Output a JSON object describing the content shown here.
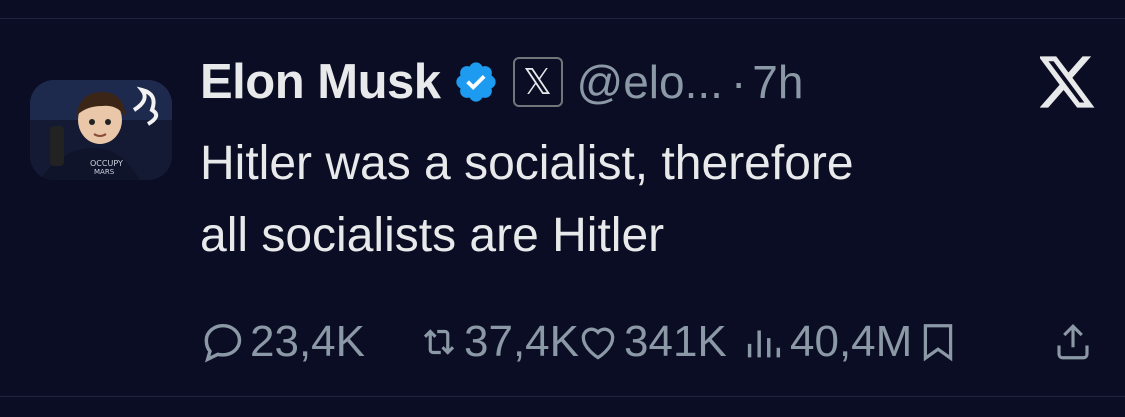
{
  "tweet": {
    "author_name": "Elon Musk",
    "verified_icon": "verified-badge-icon",
    "affiliate_badge_icon": "x-affiliate-icon",
    "affiliate_badge_text": "𝕏",
    "handle": "@elo...",
    "separator": "·",
    "time": "7h",
    "text_lines": [
      "Hitler was a socialist, therefore",
      "all socialists are Hitler"
    ]
  },
  "actions": {
    "reply": {
      "icon": "reply-icon",
      "count": "23,4K"
    },
    "repost": {
      "icon": "repost-icon",
      "count": "37,4K"
    },
    "like": {
      "icon": "heart-icon",
      "count": "341K"
    },
    "views": {
      "icon": "views-icon",
      "count": "40,4M"
    },
    "bookmark": {
      "icon": "bookmark-icon"
    },
    "share": {
      "icon": "share-icon"
    }
  },
  "colors": {
    "background": "#0b0d24",
    "text": "#e7e9ea",
    "muted": "#8b98a5",
    "verified": "#1d9bf0"
  }
}
